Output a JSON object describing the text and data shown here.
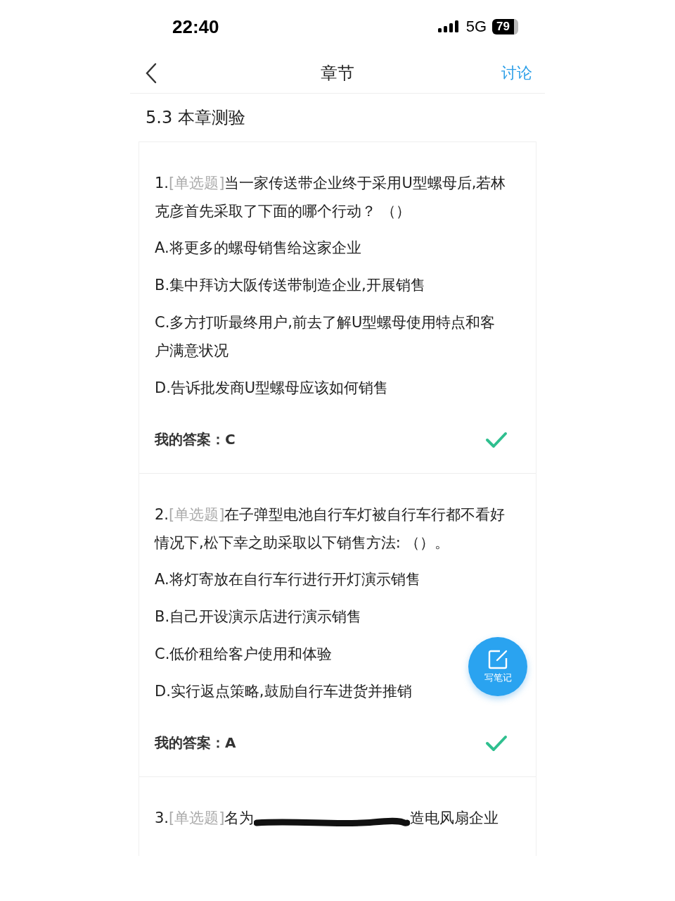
{
  "status_bar": {
    "time": "22:40",
    "network": "5G",
    "battery": "79"
  },
  "nav": {
    "title": "章节",
    "action": "讨论"
  },
  "section_title": "5.3 本章测验",
  "questions": [
    {
      "number": "1.",
      "type": "[单选题]",
      "text": "当一家传送带企业终于采用U型螺母后,若林克彦首先采取了下面的哪个行动？ （）",
      "options": [
        "A.将更多的螺母销售给这家企业",
        "B.集中拜访大阪传送带制造企业,开展销售",
        "C.多方打听最终用户,前去了解U型螺母使用特点和客户满意状况",
        "D.告诉批发商U型螺母应该如何销售"
      ],
      "answer": "我的答案：C",
      "correct": true,
      "scribbled": false
    },
    {
      "number": "2.",
      "type": "[单选题]",
      "text": "在子弹型电池自行车灯被自行车行都不看好情况下,松下幸之助采取以下销售方法: （）。",
      "options": [
        "A.将灯寄放在自行车行进行开灯演示销售",
        "B.自己开设演示店进行演示销售",
        "C.低价租给客户使用和体验",
        "D.实行返点策略,鼓励自行车进货并推销"
      ],
      "answer": "我的答案：A",
      "correct": true,
      "scribbled": false
    },
    {
      "number": "3.",
      "type": "[单选题]",
      "text": "名为",
      "scribbled": true,
      "text_after": "造电风扇企业"
    }
  ],
  "fab": {
    "label": "写笔记"
  }
}
